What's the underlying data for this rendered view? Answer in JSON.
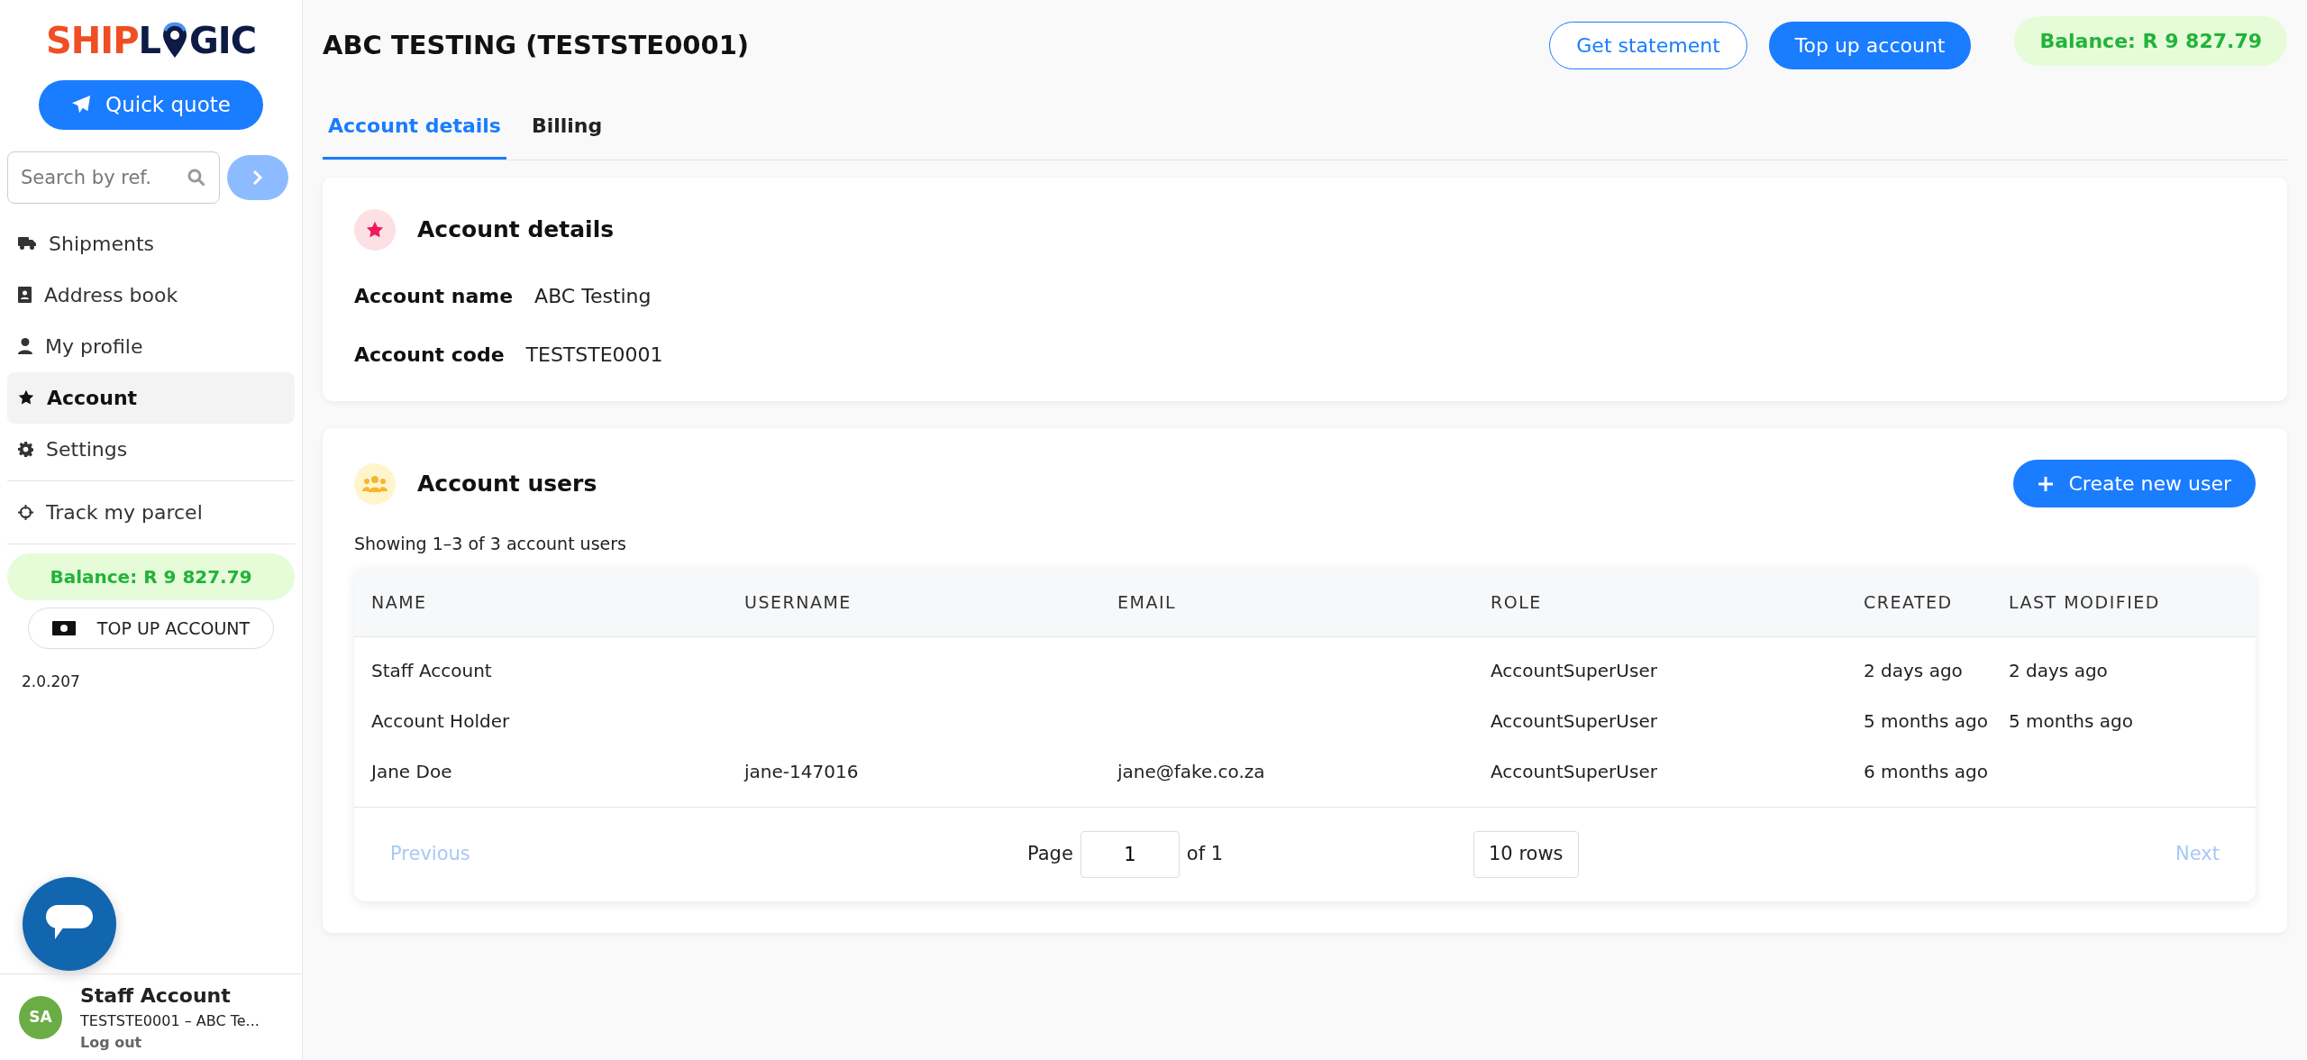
{
  "sidebar": {
    "logo": [
      "SHIP",
      "L",
      "GIC"
    ],
    "quick_quote": "Quick quote",
    "search": {
      "placeholder": "Search by ref."
    },
    "nav": [
      {
        "label": "Shipments",
        "selected": false
      },
      {
        "label": "Address book",
        "selected": false
      },
      {
        "label": "My profile",
        "selected": false
      },
      {
        "label": "Account",
        "selected": true
      },
      {
        "label": "Settings",
        "selected": false
      }
    ],
    "track": "Track my parcel",
    "balance": "Balance: R 9 827.79",
    "top_up": "TOP UP ACCOUNT",
    "version": "2.0.207",
    "user": {
      "initials": "SA",
      "name": "Staff Account",
      "subtitle": "TESTSTE0001 – ABC Te...",
      "logout": "Log out"
    }
  },
  "header": {
    "title": "ABC TESTING (TESTSTE0001)",
    "buttons": [
      "Get statement",
      "Top up account"
    ],
    "balance": "Balance: R 9 827.79"
  },
  "tabs": [
    {
      "label": "Account details",
      "selected": true
    },
    {
      "label": "Billing",
      "selected": false
    }
  ],
  "account_details": {
    "title": "Account details",
    "fields": [
      {
        "label": "Account name",
        "value": "ABC Testing"
      },
      {
        "label": "Account code",
        "value": "TESTSTE0001"
      }
    ]
  },
  "account_users": {
    "title": "Account users",
    "create_button": "Create new user",
    "summary": "Showing 1–3 of 3 account users",
    "table": {
      "columns": [
        "NAME",
        "USERNAME",
        "EMAIL",
        "ROLE",
        "CREATED",
        "LAST MODIFIED"
      ],
      "rows": [
        [
          "Staff Account",
          null,
          null,
          "AccountSuperUser",
          "2 days ago",
          "2 days ago"
        ],
        [
          "Account Holder",
          null,
          null,
          "AccountSuperUser",
          "5 months ago",
          "5 months ago"
        ],
        [
          "Jane Doe",
          "jane-147016",
          "jane@fake.co.za",
          "AccountSuperUser",
          "6 months ago",
          null
        ]
      ]
    },
    "pagination": {
      "previous": {
        "label": "Previous",
        "disabled": true
      },
      "page_label": "Page",
      "page_value": "1",
      "of_label": "of 1",
      "rows": "10 rows",
      "next": {
        "label": "Next",
        "disabled": true
      }
    }
  }
}
